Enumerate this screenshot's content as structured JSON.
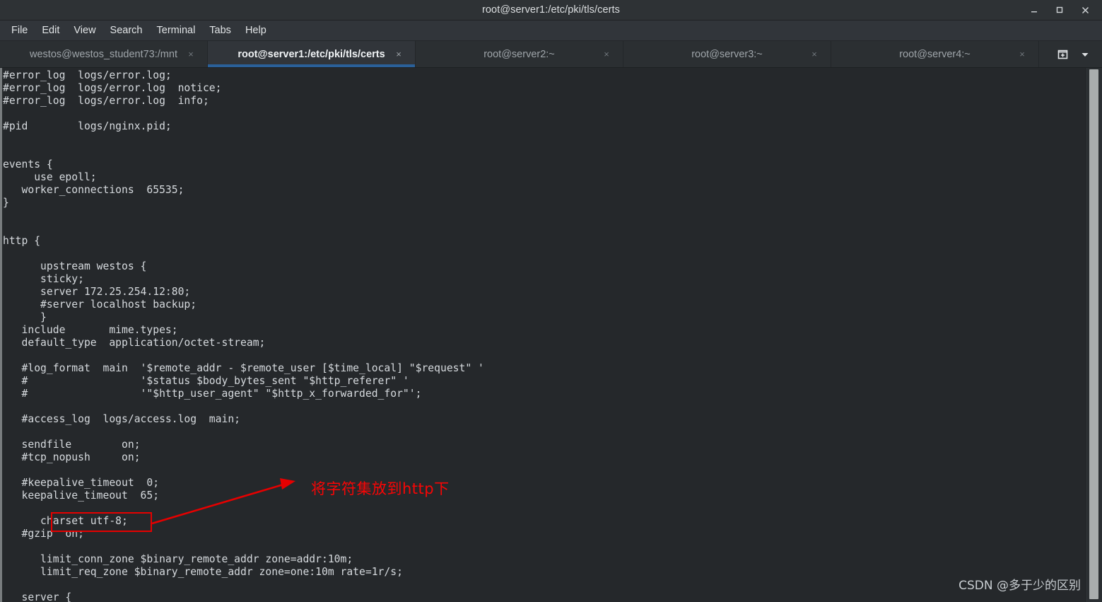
{
  "colors": {
    "accent": "#2a6099",
    "titlebar_bg": "#2e3235",
    "menubar_bg": "#31353a",
    "tabbar_bg": "#2b2f32",
    "terminal_bg": "#25282b",
    "terminal_fg": "#d6dade",
    "annotation_red": "#e60000",
    "scrollbar_thumb": "#a9adad"
  },
  "window": {
    "title": "root@server1:/etc/pki/tls/certs",
    "controls": [
      {
        "name": "minimize",
        "icon": "minimize-icon"
      },
      {
        "name": "maximize",
        "icon": "maximize-icon"
      },
      {
        "name": "close",
        "icon": "close-icon"
      }
    ]
  },
  "menubar": {
    "items": [
      {
        "label": "File"
      },
      {
        "label": "Edit"
      },
      {
        "label": "View"
      },
      {
        "label": "Search"
      },
      {
        "label": "Terminal"
      },
      {
        "label": "Tabs"
      },
      {
        "label": "Help"
      }
    ]
  },
  "tabbar": {
    "tabs": [
      {
        "label": "westos@westos_student73:/mnt",
        "active": false,
        "close": "×"
      },
      {
        "label": "root@server1:/etc/pki/tls/certs",
        "active": true,
        "close": "×"
      },
      {
        "label": "root@server2:~",
        "active": false,
        "close": "×"
      },
      {
        "label": "root@server3:~",
        "active": false,
        "close": "×"
      },
      {
        "label": "root@server4:~",
        "active": false,
        "close": "×"
      }
    ],
    "new_tab_icon": "new-tab-icon",
    "tab_list_icon": "chevron-down-icon"
  },
  "terminal": {
    "lines": [
      "#error_log  logs/error.log;",
      "#error_log  logs/error.log  notice;",
      "#error_log  logs/error.log  info;",
      "",
      "#pid        logs/nginx.pid;",
      "",
      "",
      "events {",
      "     use epoll;",
      "   worker_connections  65535;",
      "}",
      "",
      "",
      "http {",
      "",
      "      upstream westos {",
      "      sticky;",
      "      server 172.25.254.12:80;",
      "      #server localhost backup;",
      "      }",
      "   include       mime.types;",
      "   default_type  application/octet-stream;",
      "",
      "   #log_format  main  '$remote_addr - $remote_user [$time_local] \"$request\" '",
      "   #                  '$status $body_bytes_sent \"$http_referer\" '",
      "   #                  '\"$http_user_agent\" \"$http_x_forwarded_for\"';",
      "",
      "   #access_log  logs/access.log  main;",
      "",
      "   sendfile        on;",
      "   #tcp_nopush     on;",
      "",
      "   #keepalive_timeout  0;",
      "   keepalive_timeout  65;",
      "",
      "      charset utf-8;",
      "   #gzip  on;",
      "",
      "      limit_conn_zone $binary_remote_addr zone=addr:10m;",
      "      limit_req_zone $binary_remote_addr zone=one:10m rate=1r/s;",
      "",
      "   server {"
    ]
  },
  "annotation": {
    "highlight_target": "charset utf-8;",
    "note_text": "将字符集放到http下"
  },
  "watermark": {
    "text": "CSDN @多于少的区别"
  }
}
